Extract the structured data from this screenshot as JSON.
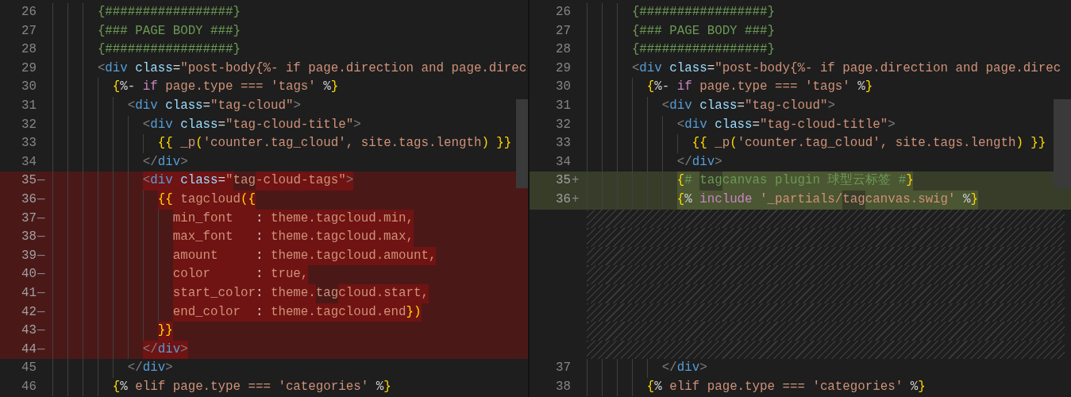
{
  "panes": [
    {
      "lines": [
        {
          "kind": "context",
          "number": "26",
          "segments": [
            {
              "text": "      {#################}",
              "kind": "comment"
            }
          ]
        },
        {
          "kind": "context",
          "number": "27",
          "segments": [
            {
              "text": "      {### PAGE BODY ###}",
              "kind": "comment"
            }
          ]
        },
        {
          "kind": "context",
          "number": "28",
          "segments": [
            {
              "text": "      {#################}",
              "kind": "comment"
            }
          ]
        },
        {
          "kind": "context",
          "number": "29",
          "segments": [
            {
              "text": "      <",
              "kind": "punct"
            },
            {
              "text": "div ",
              "kind": "tag"
            },
            {
              "text": "class",
              "kind": "attr"
            },
            {
              "text": "=",
              "kind": "op"
            },
            {
              "text": "\"post-body{%- if page.direction and page.direc",
              "kind": "str"
            }
          ]
        },
        {
          "kind": "context",
          "number": "30",
          "segments": [
            {
              "text": "        {",
              "kind": "brace"
            },
            {
              "text": "%- ",
              "kind": "op"
            },
            {
              "text": "if",
              "kind": "kw"
            },
            {
              "text": " page.type === 'tags' ",
              "kind": "str"
            },
            {
              "text": "%",
              "kind": "op"
            },
            {
              "text": "}",
              "kind": "brace"
            }
          ]
        },
        {
          "kind": "context",
          "number": "31",
          "segments": [
            {
              "text": "          <",
              "kind": "punct"
            },
            {
              "text": "div ",
              "kind": "tag"
            },
            {
              "text": "class",
              "kind": "attr"
            },
            {
              "text": "=",
              "kind": "op"
            },
            {
              "text": "\"tag-cloud\"",
              "kind": "str"
            },
            {
              "text": ">",
              "kind": "punct"
            }
          ]
        },
        {
          "kind": "context",
          "number": "32",
          "segments": [
            {
              "text": "            <",
              "kind": "punct"
            },
            {
              "text": "div ",
              "kind": "tag"
            },
            {
              "text": "class",
              "kind": "attr"
            },
            {
              "text": "=",
              "kind": "op"
            },
            {
              "text": "\"tag-cloud-title\"",
              "kind": "str"
            },
            {
              "text": ">",
              "kind": "punct"
            }
          ]
        },
        {
          "kind": "context",
          "number": "33",
          "segments": [
            {
              "text": "              {{",
              "kind": "brace"
            },
            {
              "text": " _p",
              "kind": "str"
            },
            {
              "text": "(",
              "kind": "brace"
            },
            {
              "text": "'counter.tag_cloud', site.tags.length",
              "kind": "str"
            },
            {
              "text": ")",
              "kind": "brace"
            },
            {
              "text": " }}",
              "kind": "brace"
            }
          ]
        },
        {
          "kind": "context",
          "number": "34",
          "segments": [
            {
              "text": "            </",
              "kind": "punct"
            },
            {
              "text": "div",
              "kind": "tag"
            },
            {
              "text": ">",
              "kind": "punct"
            }
          ]
        },
        {
          "kind": "removed",
          "number": "35",
          "mark": "—",
          "segments": [
            {
              "text": "            <",
              "kind": "punct",
              "changed": true
            },
            {
              "text": "div ",
              "kind": "tag",
              "changed": true
            },
            {
              "text": "class",
              "kind": "attr",
              "changed": true
            },
            {
              "text": "=",
              "kind": "op",
              "changed": true
            },
            {
              "text": "\"",
              "kind": "str",
              "changed": true
            },
            {
              "text": "tag",
              "kind": "str",
              "changed": false
            },
            {
              "text": "-cloud-tags\"",
              "kind": "str",
              "changed": true
            },
            {
              "text": ">",
              "kind": "punct",
              "changed": true
            }
          ]
        },
        {
          "kind": "removed",
          "number": "36",
          "mark": "—",
          "segments": [
            {
              "text": "              {{",
              "kind": "brace",
              "changed": true
            },
            {
              "text": " tagcloud",
              "kind": "str",
              "changed": true
            },
            {
              "text": "({",
              "kind": "brace",
              "changed": true
            }
          ]
        },
        {
          "kind": "removed",
          "number": "37",
          "mark": "—",
          "segments": [
            {
              "text": "                min_font   ",
              "kind": "str",
              "changed": true
            },
            {
              "text": ": ",
              "kind": "op",
              "changed": true
            },
            {
              "text": "theme.tagcloud.min,",
              "kind": "str",
              "changed": true
            }
          ]
        },
        {
          "kind": "removed",
          "number": "38",
          "mark": "—",
          "segments": [
            {
              "text": "                max_font   ",
              "kind": "str",
              "changed": true
            },
            {
              "text": ": ",
              "kind": "op",
              "changed": true
            },
            {
              "text": "theme.tagcloud.max,",
              "kind": "str",
              "changed": true
            }
          ]
        },
        {
          "kind": "removed",
          "number": "39",
          "mark": "—",
          "segments": [
            {
              "text": "                amount     ",
              "kind": "str",
              "changed": true
            },
            {
              "text": ": ",
              "kind": "op",
              "changed": true
            },
            {
              "text": "theme.tagcloud.amount,",
              "kind": "str",
              "changed": true
            }
          ]
        },
        {
          "kind": "removed",
          "number": "40",
          "mark": "—",
          "segments": [
            {
              "text": "                color      ",
              "kind": "str",
              "changed": true
            },
            {
              "text": ": ",
              "kind": "op",
              "changed": true
            },
            {
              "text": "true,",
              "kind": "str",
              "changed": true
            }
          ]
        },
        {
          "kind": "removed",
          "number": "41",
          "mark": "—",
          "segments": [
            {
              "text": "                start_color",
              "kind": "str",
              "changed": true
            },
            {
              "text": ": ",
              "kind": "op",
              "changed": true
            },
            {
              "text": "theme.",
              "kind": "str",
              "changed": true
            },
            {
              "text": "tag",
              "kind": "str",
              "changed": false
            },
            {
              "text": "cloud.start,",
              "kind": "str",
              "changed": true
            }
          ]
        },
        {
          "kind": "removed",
          "number": "42",
          "mark": "—",
          "segments": [
            {
              "text": "                end_color  ",
              "kind": "str",
              "changed": true
            },
            {
              "text": ": ",
              "kind": "op",
              "changed": true
            },
            {
              "text": "theme.tagcloud.end",
              "kind": "str",
              "changed": true
            },
            {
              "text": "})",
              "kind": "brace",
              "changed": true
            }
          ]
        },
        {
          "kind": "removed",
          "number": "43",
          "mark": "—",
          "segments": [
            {
              "text": "              }}",
              "kind": "brace",
              "changed": true
            }
          ]
        },
        {
          "kind": "removed",
          "number": "44",
          "mark": "—",
          "segments": [
            {
              "text": "            </",
              "kind": "punct",
              "changed": true
            },
            {
              "text": "div",
              "kind": "tag",
              "changed": true
            },
            {
              "text": ">",
              "kind": "punct",
              "changed": true
            }
          ]
        },
        {
          "kind": "context",
          "number": "45",
          "segments": [
            {
              "text": "          </",
              "kind": "punct"
            },
            {
              "text": "div",
              "kind": "tag"
            },
            {
              "text": ">",
              "kind": "punct"
            }
          ]
        },
        {
          "kind": "context",
          "number": "46",
          "segments": [
            {
              "text": "        {",
              "kind": "brace"
            },
            {
              "text": "% ",
              "kind": "op"
            },
            {
              "text": "elif page.type === 'categories' ",
              "kind": "str"
            },
            {
              "text": "%",
              "kind": "op"
            },
            {
              "text": "}",
              "kind": "brace"
            }
          ]
        }
      ]
    },
    {
      "lines": [
        {
          "kind": "context",
          "number": "26",
          "segments": [
            {
              "text": "      {#################}",
              "kind": "comment"
            }
          ]
        },
        {
          "kind": "context",
          "number": "27",
          "segments": [
            {
              "text": "      {### PAGE BODY ###}",
              "kind": "comment"
            }
          ]
        },
        {
          "kind": "context",
          "number": "28",
          "segments": [
            {
              "text": "      {#################}",
              "kind": "comment"
            }
          ]
        },
        {
          "kind": "context",
          "number": "29",
          "segments": [
            {
              "text": "      <",
              "kind": "punct"
            },
            {
              "text": "div ",
              "kind": "tag"
            },
            {
              "text": "class",
              "kind": "attr"
            },
            {
              "text": "=",
              "kind": "op"
            },
            {
              "text": "\"post-body{%- if page.direction and page.direc",
              "kind": "str"
            }
          ]
        },
        {
          "kind": "context",
          "number": "30",
          "segments": [
            {
              "text": "        {",
              "kind": "brace"
            },
            {
              "text": "%- ",
              "kind": "op"
            },
            {
              "text": "if",
              "kind": "kw"
            },
            {
              "text": " page.type === 'tags' ",
              "kind": "str"
            },
            {
              "text": "%",
              "kind": "op"
            },
            {
              "text": "}",
              "kind": "brace"
            }
          ]
        },
        {
          "kind": "context",
          "number": "31",
          "segments": [
            {
              "text": "          <",
              "kind": "punct"
            },
            {
              "text": "div ",
              "kind": "tag"
            },
            {
              "text": "class",
              "kind": "attr"
            },
            {
              "text": "=",
              "kind": "op"
            },
            {
              "text": "\"tag-cloud\"",
              "kind": "str"
            },
            {
              "text": ">",
              "kind": "punct"
            }
          ]
        },
        {
          "kind": "context",
          "number": "32",
          "segments": [
            {
              "text": "            <",
              "kind": "punct"
            },
            {
              "text": "div ",
              "kind": "tag"
            },
            {
              "text": "class",
              "kind": "attr"
            },
            {
              "text": "=",
              "kind": "op"
            },
            {
              "text": "\"tag-cloud-title\"",
              "kind": "str"
            },
            {
              "text": ">",
              "kind": "punct"
            }
          ]
        },
        {
          "kind": "context",
          "number": "33",
          "segments": [
            {
              "text": "              {{",
              "kind": "brace"
            },
            {
              "text": " _p",
              "kind": "str"
            },
            {
              "text": "(",
              "kind": "brace"
            },
            {
              "text": "'counter.tag_cloud', site.tags.length",
              "kind": "str"
            },
            {
              "text": ")",
              "kind": "brace"
            },
            {
              "text": " }}",
              "kind": "brace"
            }
          ]
        },
        {
          "kind": "context",
          "number": "34",
          "segments": [
            {
              "text": "            </",
              "kind": "punct"
            },
            {
              "text": "div",
              "kind": "tag"
            },
            {
              "text": ">",
              "kind": "punct"
            }
          ]
        },
        {
          "kind": "added",
          "number": "35",
          "mark": "+",
          "segments": [
            {
              "text": "            {",
              "kind": "brace",
              "changed": true
            },
            {
              "text": "# ",
              "kind": "comment",
              "changed": true
            },
            {
              "text": "tag",
              "kind": "comment",
              "changed": false
            },
            {
              "text": "canvas plugin 球型云标签 #",
              "kind": "comment",
              "changed": true
            },
            {
              "text": "}",
              "kind": "brace",
              "changed": true
            }
          ]
        },
        {
          "kind": "added",
          "number": "36",
          "mark": "+",
          "segments": [
            {
              "text": "            {",
              "kind": "brace",
              "changed": true
            },
            {
              "text": "% ",
              "kind": "op",
              "changed": true
            },
            {
              "text": "include",
              "kind": "kw",
              "changed": true
            },
            {
              "text": " '_partials/",
              "kind": "str",
              "changed": true
            },
            {
              "text": "tag",
              "kind": "str",
              "changed": false
            },
            {
              "text": "canvas.swig' ",
              "kind": "str",
              "changed": true
            },
            {
              "text": "%",
              "kind": "op",
              "changed": true
            },
            {
              "text": "}",
              "kind": "brace",
              "changed": true
            }
          ]
        },
        {
          "kind": "filler"
        },
        {
          "kind": "filler"
        },
        {
          "kind": "filler"
        },
        {
          "kind": "filler"
        },
        {
          "kind": "filler"
        },
        {
          "kind": "filler"
        },
        {
          "kind": "filler"
        },
        {
          "kind": "filler"
        },
        {
          "kind": "context",
          "number": "37",
          "segments": [
            {
              "text": "          </",
              "kind": "punct"
            },
            {
              "text": "div",
              "kind": "tag"
            },
            {
              "text": ">",
              "kind": "punct"
            }
          ]
        },
        {
          "kind": "context",
          "number": "38",
          "segments": [
            {
              "text": "        {",
              "kind": "brace"
            },
            {
              "text": "% ",
              "kind": "op"
            },
            {
              "text": "elif page.type === 'categories' ",
              "kind": "str"
            },
            {
              "text": "%",
              "kind": "op"
            },
            {
              "text": "}",
              "kind": "brace"
            }
          ]
        }
      ]
    }
  ]
}
